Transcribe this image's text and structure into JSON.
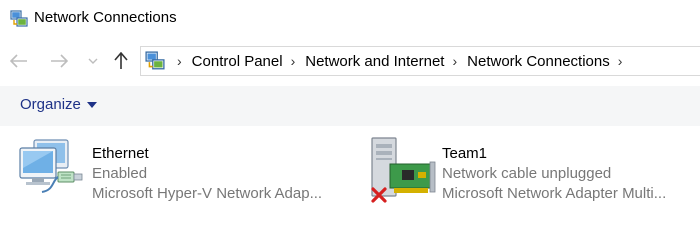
{
  "window": {
    "title": "Network Connections",
    "icon": "network-connections-icon"
  },
  "navigation": {
    "back_icon": "arrow-left-icon",
    "forward_icon": "arrow-right-icon",
    "recent_icon": "chevron-down-icon",
    "up_icon": "arrow-up-icon"
  },
  "address_bar": {
    "icon": "network-connections-icon",
    "separator": "›",
    "breadcrumbs": [
      "Control Panel",
      "Network and Internet",
      "Network Connections"
    ]
  },
  "command_bar": {
    "organize_label": "Organize"
  },
  "connections": [
    {
      "name": "Ethernet",
      "status": "Enabled",
      "device": "Microsoft Hyper-V Network Adap...",
      "icon": "ethernet-adapter-icon"
    },
    {
      "name": "Team1",
      "status": "Network cable unplugged",
      "device": "Microsoft Network Adapter Multi...",
      "icon": "network-card-icon",
      "error_icon": "red-x-icon"
    }
  ],
  "colors": {
    "command_bar_bg": "#f5f6f7",
    "organize_text": "#1e3287",
    "secondary_text": "#777777",
    "error_red": "#d62020"
  }
}
